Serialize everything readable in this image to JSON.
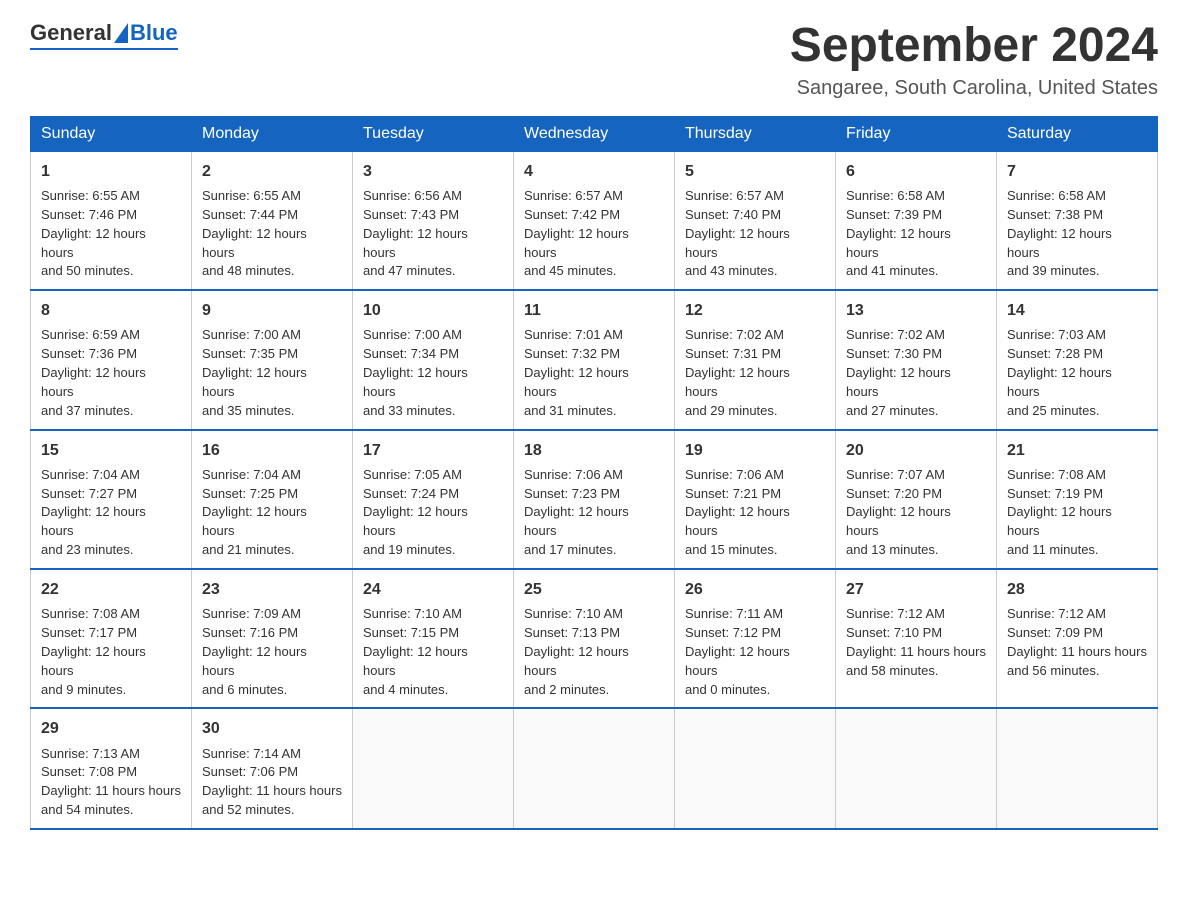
{
  "logo": {
    "general": "General",
    "blue": "Blue"
  },
  "title": "September 2024",
  "location": "Sangaree, South Carolina, United States",
  "days_of_week": [
    "Sunday",
    "Monday",
    "Tuesday",
    "Wednesday",
    "Thursday",
    "Friday",
    "Saturday"
  ],
  "weeks": [
    [
      {
        "day": "1",
        "sunrise": "6:55 AM",
        "sunset": "7:46 PM",
        "daylight": "12 hours and 50 minutes."
      },
      {
        "day": "2",
        "sunrise": "6:55 AM",
        "sunset": "7:44 PM",
        "daylight": "12 hours and 48 minutes."
      },
      {
        "day": "3",
        "sunrise": "6:56 AM",
        "sunset": "7:43 PM",
        "daylight": "12 hours and 47 minutes."
      },
      {
        "day": "4",
        "sunrise": "6:57 AM",
        "sunset": "7:42 PM",
        "daylight": "12 hours and 45 minutes."
      },
      {
        "day": "5",
        "sunrise": "6:57 AM",
        "sunset": "7:40 PM",
        "daylight": "12 hours and 43 minutes."
      },
      {
        "day": "6",
        "sunrise": "6:58 AM",
        "sunset": "7:39 PM",
        "daylight": "12 hours and 41 minutes."
      },
      {
        "day": "7",
        "sunrise": "6:58 AM",
        "sunset": "7:38 PM",
        "daylight": "12 hours and 39 minutes."
      }
    ],
    [
      {
        "day": "8",
        "sunrise": "6:59 AM",
        "sunset": "7:36 PM",
        "daylight": "12 hours and 37 minutes."
      },
      {
        "day": "9",
        "sunrise": "7:00 AM",
        "sunset": "7:35 PM",
        "daylight": "12 hours and 35 minutes."
      },
      {
        "day": "10",
        "sunrise": "7:00 AM",
        "sunset": "7:34 PM",
        "daylight": "12 hours and 33 minutes."
      },
      {
        "day": "11",
        "sunrise": "7:01 AM",
        "sunset": "7:32 PM",
        "daylight": "12 hours and 31 minutes."
      },
      {
        "day": "12",
        "sunrise": "7:02 AM",
        "sunset": "7:31 PM",
        "daylight": "12 hours and 29 minutes."
      },
      {
        "day": "13",
        "sunrise": "7:02 AM",
        "sunset": "7:30 PM",
        "daylight": "12 hours and 27 minutes."
      },
      {
        "day": "14",
        "sunrise": "7:03 AM",
        "sunset": "7:28 PM",
        "daylight": "12 hours and 25 minutes."
      }
    ],
    [
      {
        "day": "15",
        "sunrise": "7:04 AM",
        "sunset": "7:27 PM",
        "daylight": "12 hours and 23 minutes."
      },
      {
        "day": "16",
        "sunrise": "7:04 AM",
        "sunset": "7:25 PM",
        "daylight": "12 hours and 21 minutes."
      },
      {
        "day": "17",
        "sunrise": "7:05 AM",
        "sunset": "7:24 PM",
        "daylight": "12 hours and 19 minutes."
      },
      {
        "day": "18",
        "sunrise": "7:06 AM",
        "sunset": "7:23 PM",
        "daylight": "12 hours and 17 minutes."
      },
      {
        "day": "19",
        "sunrise": "7:06 AM",
        "sunset": "7:21 PM",
        "daylight": "12 hours and 15 minutes."
      },
      {
        "day": "20",
        "sunrise": "7:07 AM",
        "sunset": "7:20 PM",
        "daylight": "12 hours and 13 minutes."
      },
      {
        "day": "21",
        "sunrise": "7:08 AM",
        "sunset": "7:19 PM",
        "daylight": "12 hours and 11 minutes."
      }
    ],
    [
      {
        "day": "22",
        "sunrise": "7:08 AM",
        "sunset": "7:17 PM",
        "daylight": "12 hours and 9 minutes."
      },
      {
        "day": "23",
        "sunrise": "7:09 AM",
        "sunset": "7:16 PM",
        "daylight": "12 hours and 6 minutes."
      },
      {
        "day": "24",
        "sunrise": "7:10 AM",
        "sunset": "7:15 PM",
        "daylight": "12 hours and 4 minutes."
      },
      {
        "day": "25",
        "sunrise": "7:10 AM",
        "sunset": "7:13 PM",
        "daylight": "12 hours and 2 minutes."
      },
      {
        "day": "26",
        "sunrise": "7:11 AM",
        "sunset": "7:12 PM",
        "daylight": "12 hours and 0 minutes."
      },
      {
        "day": "27",
        "sunrise": "7:12 AM",
        "sunset": "7:10 PM",
        "daylight": "11 hours and 58 minutes."
      },
      {
        "day": "28",
        "sunrise": "7:12 AM",
        "sunset": "7:09 PM",
        "daylight": "11 hours and 56 minutes."
      }
    ],
    [
      {
        "day": "29",
        "sunrise": "7:13 AM",
        "sunset": "7:08 PM",
        "daylight": "11 hours and 54 minutes."
      },
      {
        "day": "30",
        "sunrise": "7:14 AM",
        "sunset": "7:06 PM",
        "daylight": "11 hours and 52 minutes."
      },
      null,
      null,
      null,
      null,
      null
    ]
  ],
  "labels": {
    "sunrise": "Sunrise:",
    "sunset": "Sunset:",
    "daylight": "Daylight:"
  }
}
